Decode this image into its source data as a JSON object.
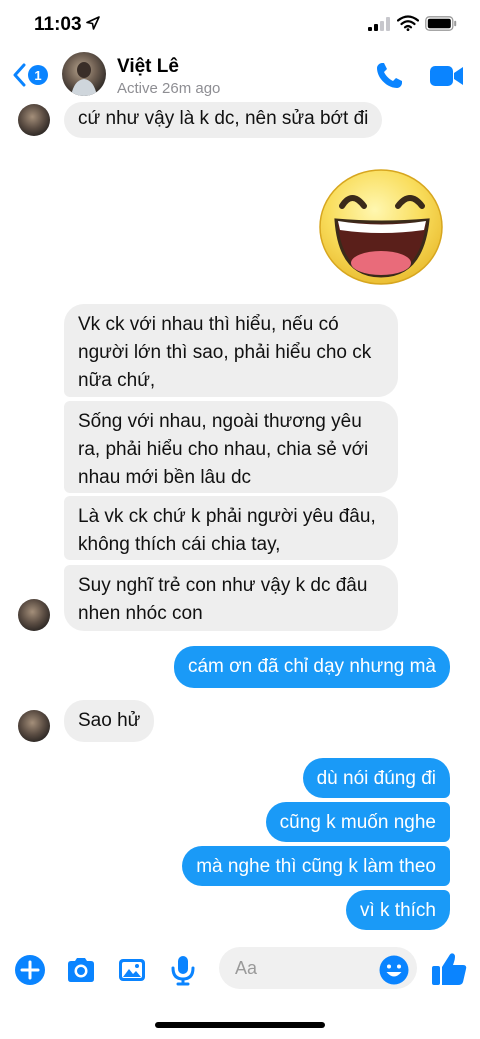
{
  "status_bar": {
    "time": "11:03",
    "icons": [
      "location-arrow-icon",
      "signal-icon",
      "wifi-icon",
      "battery-icon"
    ]
  },
  "header": {
    "back_badge": "1",
    "contact_name": "Việt Lê",
    "active_status": "Active 26m ago",
    "icons": [
      "back-chevron-icon",
      "phone-icon",
      "video-camera-icon"
    ],
    "accent_color": "#0a84ff"
  },
  "messages": [
    {
      "from": "contact",
      "text": "cứ như vậy là k dc, nên sửa bớt đi"
    },
    {
      "from": "me",
      "type": "sticker",
      "sticker": "laughing-face-sticker"
    },
    {
      "from": "contact",
      "text": "Vk ck với nhau thì hiểu, nếu có người lớn thì sao, phải hiểu cho ck nữa chứ,"
    },
    {
      "from": "contact",
      "text": "Sống với nhau, ngoài thương yêu ra, phải hiểu cho nhau, chia sẻ với nhau mới bền lâu dc"
    },
    {
      "from": "contact",
      "text": "Là vk ck chứ k phải người yêu đâu, không thích cái chia tay,"
    },
    {
      "from": "contact",
      "text": "Suy nghĩ trẻ con như vậy k dc đâu nhen nhóc con"
    },
    {
      "from": "me",
      "text": "cám ơn đã chỉ dạy nhưng mà"
    },
    {
      "from": "contact",
      "text": "Sao hử"
    },
    {
      "from": "me",
      "text": "dù nói đúng đi"
    },
    {
      "from": "me",
      "text": "cũng k muốn nghe"
    },
    {
      "from": "me",
      "text": "mà nghe thì cũng k làm theo"
    },
    {
      "from": "me",
      "text": "vì k thích"
    }
  ],
  "composer": {
    "placeholder": "Aa",
    "icons": [
      "plus-icon",
      "camera-icon",
      "photo-icon",
      "microphone-icon",
      "emoji-icon",
      "thumbs-up-icon"
    ]
  },
  "colors": {
    "outgoing_bubble": "#1a9af7",
    "incoming_bubble": "#eeeeee"
  }
}
